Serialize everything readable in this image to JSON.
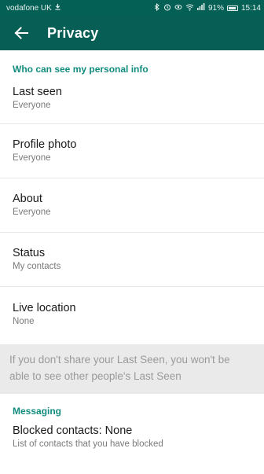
{
  "status_bar": {
    "carrier": "vodafone UK",
    "battery": "91%",
    "time": "15:14"
  },
  "app_bar": {
    "title": "Privacy"
  },
  "section_personal": {
    "header": "Who can see my personal info",
    "items": [
      {
        "title": "Last seen",
        "summary": "Everyone"
      },
      {
        "title": "Profile photo",
        "summary": "Everyone"
      },
      {
        "title": "About",
        "summary": "Everyone"
      },
      {
        "title": "Status",
        "summary": "My contacts"
      },
      {
        "title": "Live location",
        "summary": "None"
      }
    ]
  },
  "info_note": "If you don't share your Last Seen, you won't be able to see other people's Last Seen",
  "section_messaging": {
    "header": "Messaging",
    "items": [
      {
        "title": "Blocked contacts: None",
        "summary": "List of contacts that you have blocked"
      }
    ]
  },
  "colors": {
    "app_bar": "#075e54",
    "status_bar": "#045f54",
    "accent": "#128c7e"
  }
}
